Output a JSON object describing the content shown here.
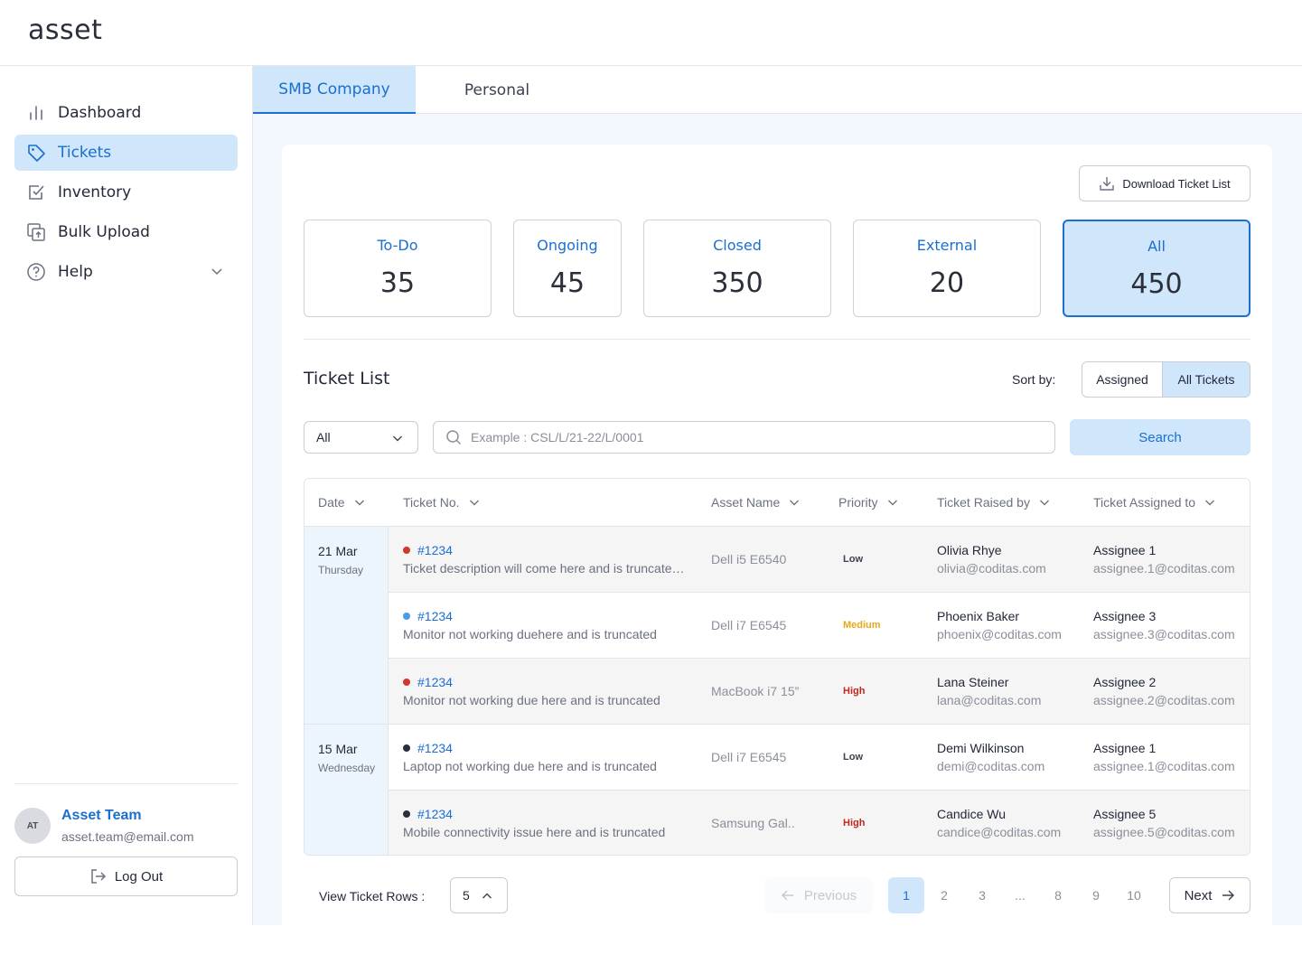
{
  "app": {
    "logo": "asset"
  },
  "sidebar": {
    "items": [
      {
        "label": "Dashboard",
        "icon": "bar-chart-icon"
      },
      {
        "label": "Tickets",
        "icon": "tag-icon",
        "active": true
      },
      {
        "label": "Inventory",
        "icon": "checkbox-icon"
      },
      {
        "label": "Bulk Upload",
        "icon": "upload-icon"
      },
      {
        "label": "Help",
        "icon": "question-circle-icon",
        "expandable": true
      }
    ],
    "user": {
      "initials": "AT",
      "name": "Asset Team",
      "email": "asset.team@email.com"
    },
    "logout_label": "Log Out"
  },
  "tabs": [
    {
      "label": "SMB Company",
      "active": true
    },
    {
      "label": "Personal",
      "active": false
    }
  ],
  "download_label": "Download Ticket List",
  "stats": [
    {
      "label": "To-Do",
      "value": "35"
    },
    {
      "label": "Ongoing",
      "value": "45"
    },
    {
      "label": "Closed",
      "value": "350"
    },
    {
      "label": "External",
      "value": "20"
    },
    {
      "label": "All",
      "value": "450",
      "active": true
    }
  ],
  "ticket_list": {
    "title": "Ticket List",
    "sort_label": "Sort by:",
    "sort_options": [
      "Assigned",
      "All Tickets"
    ],
    "sort_selected": "All Tickets",
    "filter_value": "All",
    "search_placeholder": "Example : CSL/L/21-22/L/0001",
    "search_button": "Search",
    "columns": [
      "Date",
      "Ticket No.",
      "Asset Name",
      "Priority",
      "Ticket Raised by",
      "Ticket Assigned to"
    ],
    "date_groups": [
      {
        "date": "21 Mar",
        "day": "Thursday"
      },
      {
        "date": "15 Mar",
        "day": "Wednesday"
      }
    ],
    "rows": [
      {
        "number": "#1234",
        "description": "Ticket description will come here and is truncated and is truncated",
        "asset": "Dell i5 E6540",
        "priority": "Low",
        "raised_name": "Olivia Rhye",
        "raised_email": "olivia@coditas.com",
        "assignee": "Assignee 1",
        "assignee_email": "assignee.1@coditas.com",
        "dot_color": "#d0392b"
      },
      {
        "number": "#1234",
        "description": "Monitor not working duehere and is truncated",
        "asset": "Dell i7 E6545",
        "priority": "Medium",
        "raised_name": "Phoenix Baker",
        "raised_email": "phoenix@coditas.com",
        "assignee": "Assignee 3",
        "assignee_email": "assignee.3@coditas.com",
        "dot_color": "#4a9be8"
      },
      {
        "number": "#1234",
        "description": "Monitor not working due here and is truncated",
        "asset": "MacBook i7 15”",
        "priority": "High",
        "raised_name": "Lana Steiner",
        "raised_email": "lana@coditas.com",
        "assignee": "Assignee 2",
        "assignee_email": "assignee.2@coditas.com",
        "dot_color": "#d0392b"
      },
      {
        "number": "#1234",
        "description": "Laptop not working due here and is truncated",
        "asset": "Dell i7 E6545",
        "priority": "Low",
        "raised_name": "Demi Wilkinson",
        "raised_email": "demi@coditas.com",
        "assignee": "Assignee 1",
        "assignee_email": "assignee.1@coditas.com",
        "dot_color": "#2a2f3a"
      },
      {
        "number": "#1234",
        "description": "Mobile connectivity issue here and is truncated",
        "asset": "Samsung Gal..",
        "priority": "High",
        "raised_name": "Candice Wu",
        "raised_email": "candice@coditas.com",
        "assignee": "Assignee 5",
        "assignee_email": "assignee.5@coditas.com",
        "dot_color": "#2a2f3a"
      }
    ]
  },
  "pagination": {
    "rows_label": "View Ticket Rows :",
    "rows_value": "5",
    "previous_label": "Previous",
    "next_label": "Next",
    "pages": [
      "1",
      "2",
      "3",
      "...",
      "8",
      "9",
      "10"
    ],
    "current": "1"
  },
  "colors": {
    "accent": "#1b6fd0",
    "accent_light": "#cfe6fb",
    "priority_low": "#3c4150",
    "priority_medium": "#e6a817",
    "priority_high": "#c0281e"
  }
}
